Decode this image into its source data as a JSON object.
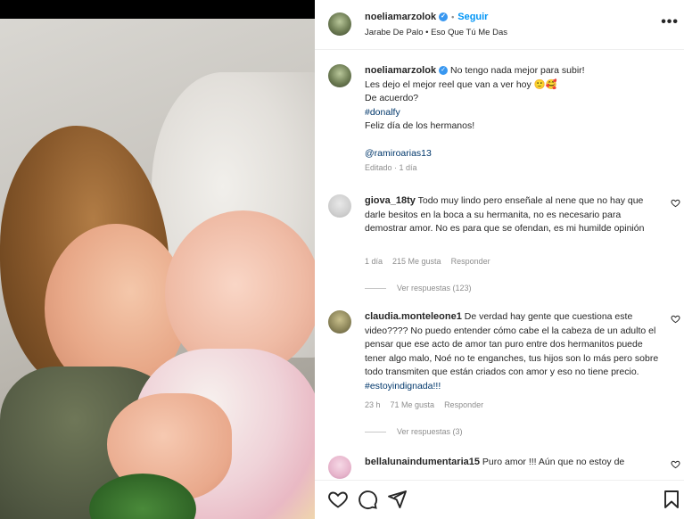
{
  "post": {
    "username": "noeliamarzolok",
    "follow_label": "Seguir",
    "audio": "Jarabe De Palo • Eso Que Tú Me Das",
    "more_label": "•••"
  },
  "caption": {
    "username": "noeliamarzolok",
    "line1": "No tengo nada mejor para subir!",
    "line2": "Les dejo el mejor reel que van a ver hoy 🙂🥰",
    "line3": "De acuerdo?",
    "hashtag": "#donalfy",
    "line4": "Feliz día de los hermanos!",
    "mention": "@ramiroarias13",
    "meta": "Editado · 1 día"
  },
  "comments": [
    {
      "username": "giova_18ty",
      "text": "Todo muy lindo pero enseñale al nene que no hay que darle besitos en la boca a su hermanita, no es necesario para demostrar amor. No es para que se ofendan, es mi humilde opinión",
      "time": "1 día",
      "likes": "215 Me gusta",
      "reply": "Responder",
      "replies": "Ver respuestas (123)"
    },
    {
      "username": "claudia.monteleone1",
      "text": "De verdad hay gente que cuestiona este video???? No puedo entender cómo cabe el la cabeza de un adulto el pensar que ese acto de amor tan puro entre dos hermanitos puede tener algo malo, Noé no te enganches, tus hijos son lo más pero sobre todo transmiten que están criados con amor y eso no tiene precio.",
      "hashtag": "#estoyindignada!!!",
      "time": "23 h",
      "likes": "71 Me gusta",
      "reply": "Responder",
      "replies": "Ver respuestas (3)"
    },
    {
      "username": "bellalunaindumentaria15",
      "text": "Puro amor !!! Aún que no estoy de"
    }
  ],
  "icons": {
    "like": "heart-icon",
    "comment": "comment-icon",
    "share": "share-icon",
    "save": "bookmark-icon"
  },
  "colors": {
    "accent": "#0095f6",
    "verified": "#3897f0",
    "link": "#00376b",
    "muted": "#8e8e8e"
  }
}
